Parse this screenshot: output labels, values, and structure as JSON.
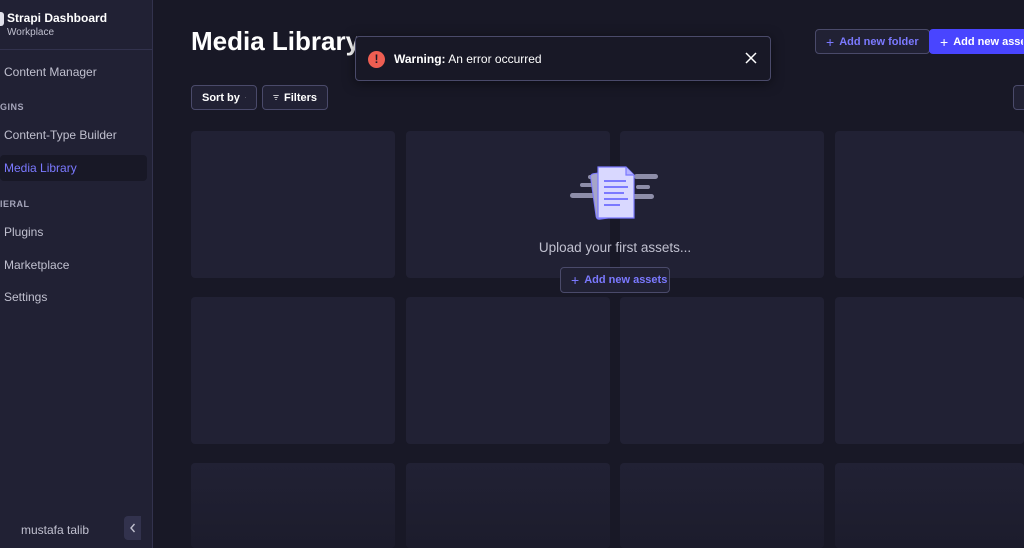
{
  "brand": {
    "title": "Strapi Dashboard",
    "subtitle": "Workplace"
  },
  "sidebar": {
    "content_manager": "Content Manager",
    "plugins_section": "GINS",
    "content_type_builder": "Content-Type Builder",
    "media_library": "Media Library",
    "general_section": "IERAL",
    "plugins": "Plugins",
    "marketplace": "Marketplace",
    "settings": "Settings",
    "user": "mustafa talib",
    "collapse_icon": "chevron-left-icon"
  },
  "header": {
    "title": "Media Library",
    "add_folder": "Add new folder",
    "add_assets": "Add new assets"
  },
  "toolbar": {
    "sort_by": "Sort by",
    "filters": "Filters"
  },
  "empty_state": {
    "message": "Upload your first assets...",
    "button": "Add new assets"
  },
  "toast": {
    "prefix": "Warning:",
    "message": "An error occurred",
    "icon": "alert-circle-icon"
  },
  "colors": {
    "accent": "#4945ff",
    "accent_text": "#7b79ff",
    "danger": "#ee5e52",
    "background": "#181826",
    "surface": "#212134"
  }
}
